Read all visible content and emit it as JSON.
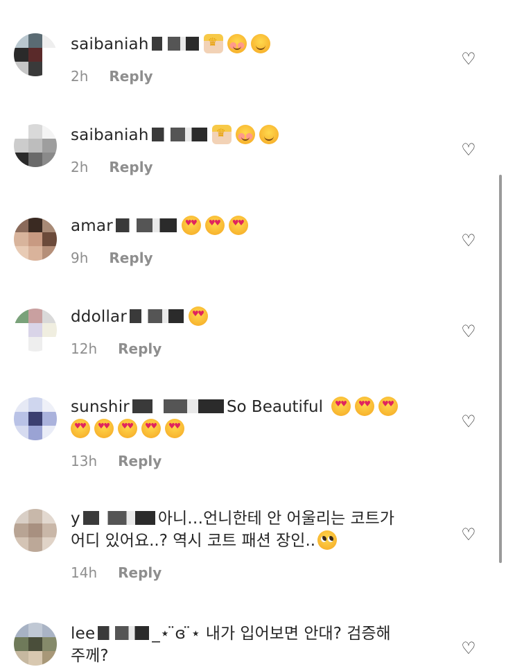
{
  "comments": [
    {
      "username": "saibaniah",
      "text": "",
      "time": "2h",
      "reply": "Reply"
    },
    {
      "username": "saibaniah",
      "text": "",
      "time": "2h",
      "reply": "Reply"
    },
    {
      "username": "amar",
      "text": "",
      "time": "9h",
      "reply": "Reply"
    },
    {
      "username": "ddollar",
      "text": "",
      "time": "12h",
      "reply": "Reply"
    },
    {
      "username": "sunshir",
      "text": "So Beautiful",
      "time": "13h",
      "reply": "Reply"
    },
    {
      "username": "y",
      "text": "아니…언니한테 안 어울리는 코트가",
      "text2": "어디 있어요..? 역시 코트 패션 장인..",
      "time": "14h",
      "reply": "Reply"
    },
    {
      "username": "lee",
      "text": "_⋆ ̈ɞ ̈⋆ 내가 입어보면 안대? 검증해",
      "text2": "주께?",
      "time": "",
      "reply": ""
    }
  ],
  "icons": {
    "like": "heart-outline-icon"
  }
}
